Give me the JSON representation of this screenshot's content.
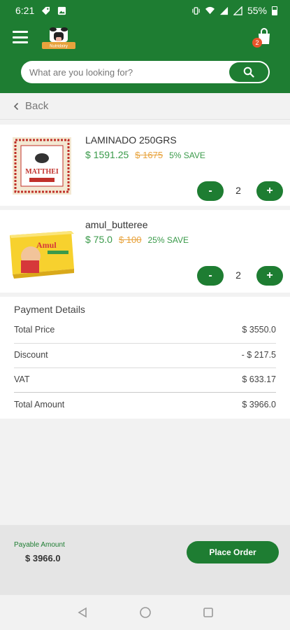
{
  "status_bar": {
    "time": "6:21",
    "battery": "55%"
  },
  "header": {
    "cart_count": "2",
    "logo_text": "Nutridairy"
  },
  "search": {
    "placeholder": "What are you looking for?"
  },
  "back": {
    "label": "Back"
  },
  "products": [
    {
      "name": "LAMINADO 250GRS",
      "price": "$ 1591.25",
      "old_price": "$ 1675",
      "save": "5% SAVE",
      "qty": "2",
      "minus": "-",
      "plus": "+",
      "image_label": "MATTHEI"
    },
    {
      "name": "amul_butteree",
      "price": "$ 75.0",
      "old_price": "$ 100",
      "save": "25% SAVE",
      "qty": "2",
      "minus": "-",
      "plus": "+",
      "image_label": "Amul"
    }
  ],
  "payment": {
    "title": "Payment Details",
    "rows": [
      {
        "label": "Total Price",
        "value": "$ 3550.0"
      },
      {
        "label": "Discount",
        "value": "- $ 217.5"
      },
      {
        "label": "VAT",
        "value": "$ 633.17"
      },
      {
        "label": "Total Amount",
        "value": "$ 3966.0"
      }
    ]
  },
  "footer": {
    "payable_label": "Payable Amount",
    "payable_value": "$ 3966.0",
    "place_order": "Place Order"
  },
  "colors": {
    "primary": "#1e7d32",
    "price_green": "#3a9a4a",
    "old_price": "#e8a33d",
    "badge": "#e8542a"
  }
}
